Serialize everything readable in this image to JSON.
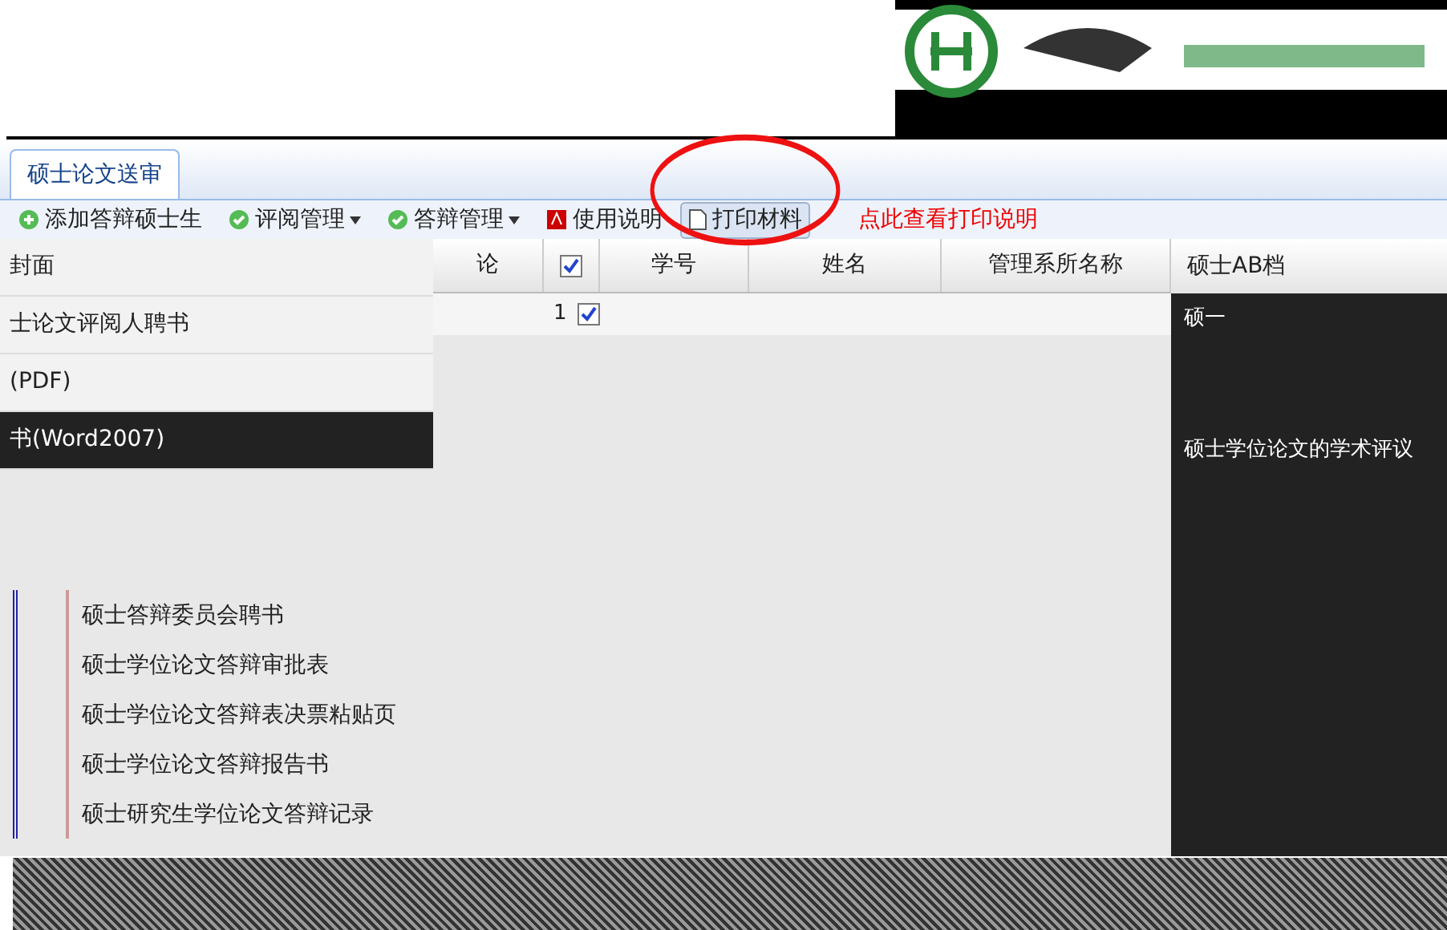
{
  "tabs": [
    {
      "label": "硕士论文送审",
      "selected": true
    }
  ],
  "toolbar": [
    {
      "label": "添加答辩硕士生",
      "kind": "add",
      "dropdown": false,
      "active": false
    },
    {
      "label": "评阅管理",
      "kind": "check",
      "dropdown": true,
      "active": false
    },
    {
      "label": "答辩管理",
      "kind": "check",
      "dropdown": true,
      "active": false
    },
    {
      "label": "使用说明",
      "kind": "pdf",
      "dropdown": false,
      "active": false
    },
    {
      "label": "打印材料",
      "kind": "doc",
      "dropdown": false,
      "active": true
    }
  ],
  "print_hint": "点此查看打印说明",
  "left_panel": [
    {
      "label": "封面",
      "dark": false
    },
    {
      "label": "士论文评阅人聘书",
      "dark": false
    },
    {
      "label": "(PDF)",
      "dark": false
    },
    {
      "label": "书(Word2007)",
      "dark": true
    }
  ],
  "grid": {
    "columns": [
      "论",
      "学号",
      "姓名",
      "管理系所名称"
    ],
    "header_checked": true,
    "rows": [
      {
        "index": "1",
        "checked": true
      }
    ],
    "next_column": "硕士AB档",
    "next_cell": "硕一"
  },
  "right_panel": [
    "硕士学位论文的学术评议"
  ],
  "menu": [
    "硕士答辩委员会聘书",
    "硕士学位论文答辩审批表",
    "硕士学位论文答辩表决票粘贴页",
    "硕士学位论文答辩报告书",
    "硕士研究生学位论文答辩记录"
  ]
}
